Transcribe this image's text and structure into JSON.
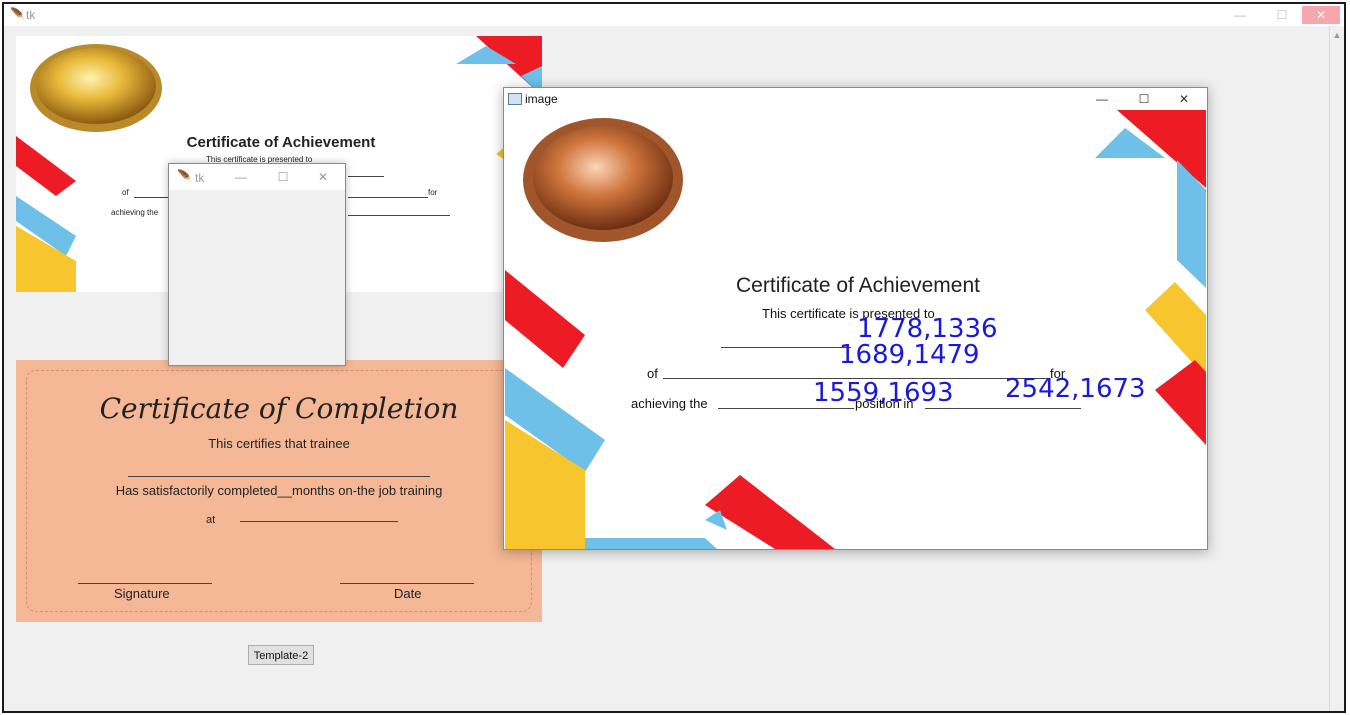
{
  "main_window": {
    "title": "tk",
    "controls": {
      "minimize": "—",
      "maximize": "☐",
      "close": "✕"
    }
  },
  "certificate_1": {
    "title": "Certificate of Achievement",
    "presented_to": "This certificate is presented to",
    "of": "of",
    "for": "for",
    "achieving": "achieving the"
  },
  "certificate_2": {
    "title": "Certificate of Completion",
    "certifies": "This certifies that trainee",
    "completed": "Has satisfactorily completed__months on-the job training",
    "at": "at",
    "signature": "Signature",
    "date": "Date"
  },
  "template_button": {
    "label": "Template-2"
  },
  "tk_window": {
    "title": "tk",
    "controls": {
      "minimize": "—",
      "maximize": "☐",
      "close": "✕"
    }
  },
  "image_window": {
    "title": "image",
    "controls": {
      "minimize": "—",
      "maximize": "☐",
      "close": "✕"
    },
    "certificate": {
      "title": "Certificate of Achievement",
      "presented_to": "This certificate is presented to",
      "of": "of",
      "for": "for",
      "achieving": "achieving the",
      "position_in": "position in"
    },
    "coordinates": [
      "1778,1336",
      "1689,1479",
      "1559,1693",
      "2542,1673"
    ]
  },
  "colors": {
    "red": "#ed1c24",
    "blue": "#6fc0e8",
    "yellow": "#f7c62f",
    "peach": "#f5b896",
    "annotation_blue": "#1a1ad6"
  }
}
